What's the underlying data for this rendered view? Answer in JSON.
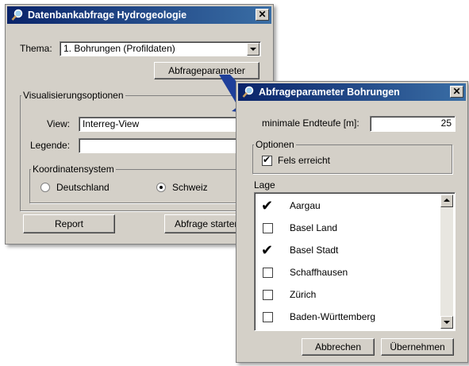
{
  "main": {
    "title": "Datenbankabfrage Hydrogeologie",
    "close_label": "✕",
    "theme_label": "Thema:",
    "theme_value": "1. Bohrungen (Profildaten)",
    "query_params_button": "Abfrageparameter",
    "vis_group": "Visualisierungsoptionen",
    "view_label": "View:",
    "view_value": "Interreg-View",
    "legend_label": "Legende:",
    "legend_value": "",
    "coord_group": "Koordinatensystem",
    "radio_de": "Deutschland",
    "radio_ch": "Schweiz",
    "selected_coord": "Schweiz",
    "report_button": "Report",
    "start_button": "Abfrage starten"
  },
  "sub": {
    "title": "Abfrageparameter Bohrungen",
    "close_label": "✕",
    "min_depth_label": "minimale Endteufe [m]:",
    "min_depth_value": "25",
    "options_group": "Optionen",
    "fels_label": "Fels erreicht",
    "fels_checked": true,
    "check_mark": "✔",
    "lage_label": "Lage",
    "items": [
      {
        "label": "Aargau",
        "checked": true
      },
      {
        "label": "Basel Land",
        "checked": false
      },
      {
        "label": "Basel Stadt",
        "checked": true
      },
      {
        "label": "Schaffhausen",
        "checked": false
      },
      {
        "label": "Zürich",
        "checked": false
      },
      {
        "label": "Baden-Württemberg",
        "checked": false
      }
    ],
    "cancel_button": "Abbrechen",
    "apply_button": "Übernehmen"
  },
  "colors": {
    "titlebar_start": "#0a246a",
    "titlebar_end": "#3a6ea5",
    "window_bg": "#d4d0c8",
    "arrow": "#1f3f9a"
  }
}
